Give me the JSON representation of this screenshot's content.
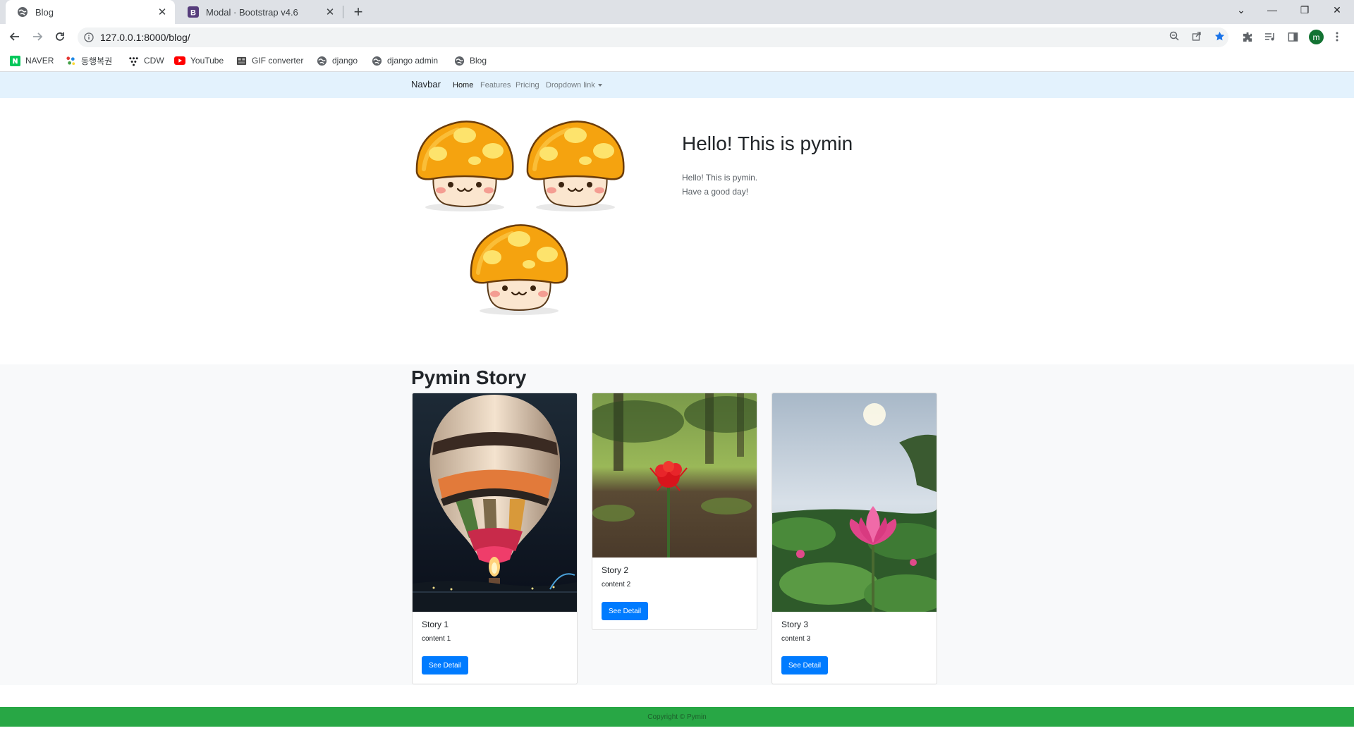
{
  "browser": {
    "tabs": [
      {
        "title": "Blog",
        "icon": "globe-icon"
      },
      {
        "title": "Modal · Bootstrap v4.6",
        "icon": "bootstrap-icon"
      }
    ],
    "url": "127.0.0.1:8000/blog/",
    "bookmarks": [
      {
        "label": "NAVER",
        "icon": "naver-icon",
        "color": "#03c75a"
      },
      {
        "label": "동행복권",
        "icon": "lottery-icon",
        "color": "#2b6cb0"
      },
      {
        "label": "CDW",
        "icon": "dots-icon",
        "color": "#202124"
      },
      {
        "label": "YouTube",
        "icon": "youtube-icon",
        "color": "#ff0000"
      },
      {
        "label": "GIF converter",
        "icon": "gif-icon",
        "color": "#444444"
      },
      {
        "label": "django",
        "icon": "globe-icon",
        "color": "#5f6368"
      },
      {
        "label": "django admin",
        "icon": "globe-icon",
        "color": "#5f6368"
      },
      {
        "label": "Blog",
        "icon": "globe-icon",
        "color": "#5f6368"
      }
    ],
    "profile_initial": "m"
  },
  "navbar": {
    "brand": "Navbar",
    "links": [
      "Home",
      "Features",
      "Pricing",
      "Dropdown link"
    ]
  },
  "hero": {
    "title": "Hello! This is pymin",
    "lines": [
      "Hello! This is pymin.",
      "Have a good day!"
    ]
  },
  "stories": {
    "heading": "Pymin Story",
    "cards": [
      {
        "title": "Story 1",
        "content": "content 1",
        "button": "See Detail"
      },
      {
        "title": "Story 2",
        "content": "content 2",
        "button": "See Detail"
      },
      {
        "title": "Story 3",
        "content": "content 3",
        "button": "See Detail"
      }
    ]
  },
  "footer": {
    "text": "Copyright © Pymin"
  },
  "colors": {
    "navbar_bg": "#e3f2fd",
    "primary": "#007bff",
    "footer_bg": "#28a745",
    "mushroom_cap": "#f5a30f"
  }
}
